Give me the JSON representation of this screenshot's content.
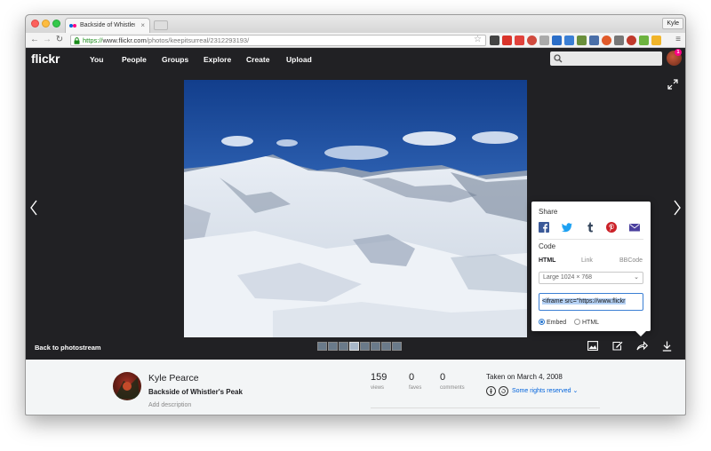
{
  "browser": {
    "tab_title": "Backside of Whistler's Peak",
    "tab_close": "×",
    "user": "Kyle",
    "url_scheme": "https://",
    "url_host": "www.flickr.com",
    "url_path": "/photos/keepitsurreal/2312293193/"
  },
  "nav": {
    "logo": "flickr",
    "items": [
      "You",
      "People",
      "Groups",
      "Explore",
      "Create",
      "Upload"
    ],
    "notification_count": "1"
  },
  "viewer": {
    "back_label": "Back to photostream"
  },
  "share": {
    "share_heading": "Share",
    "code_heading": "Code",
    "tabs": [
      "HTML",
      "Link",
      "BBCode"
    ],
    "size_option": "Large 1024 × 768",
    "code_value": "<iframe src=\"https://www.flickr",
    "radio_embed": "Embed",
    "radio_html": "HTML"
  },
  "info": {
    "owner": "Kyle Pearce",
    "title": "Backside of Whistler's Peak",
    "add_description": "Add description",
    "stats": [
      {
        "value": "159",
        "label": "views"
      },
      {
        "value": "0",
        "label": "faves"
      },
      {
        "value": "0",
        "label": "comments"
      }
    ],
    "taken": "Taken on March 4, 2008",
    "rights": "Some rights reserved"
  },
  "colors": {
    "flickr_dark": "#212124",
    "flickr_blue": "#0063dc",
    "flickr_pink": "#ff0084"
  }
}
